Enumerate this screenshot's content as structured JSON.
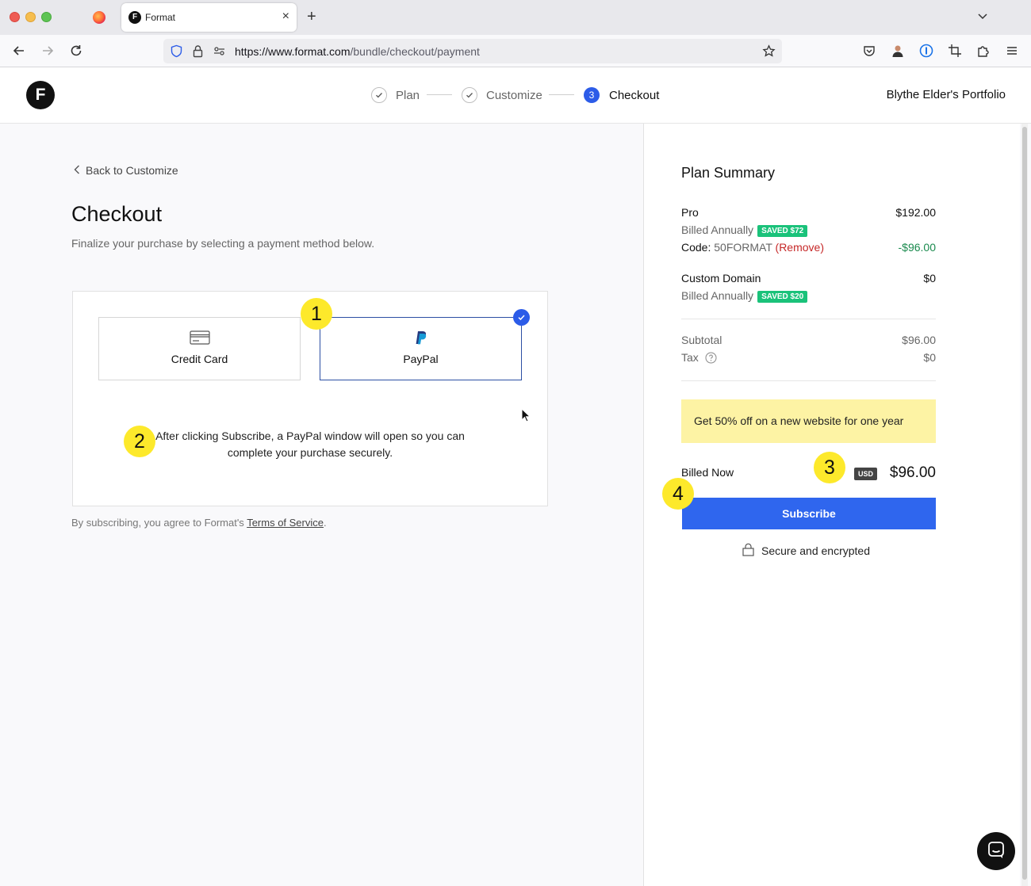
{
  "browser": {
    "tab_title": "Format",
    "tab_favicon_letter": "F",
    "url_scheme_host": "https://www.format.com",
    "url_path": "/bundle/checkout/payment"
  },
  "header": {
    "logo_letter": "F",
    "steps": [
      {
        "label": "Plan",
        "state": "done"
      },
      {
        "label": "Customize",
        "state": "done"
      },
      {
        "label": "Checkout",
        "state": "active",
        "number": "3"
      }
    ],
    "portfolio_name": "Blythe Elder's Portfolio"
  },
  "checkout": {
    "back_label": "Back to Customize",
    "title": "Checkout",
    "subtitle": "Finalize your purchase by selecting a payment method below.",
    "payment_options": [
      {
        "label": "Credit Card",
        "icon": "credit-card-icon",
        "selected": false
      },
      {
        "label": "PayPal",
        "icon": "paypal-icon",
        "selected": true
      }
    ],
    "paypal_info": "After clicking Subscribe, a PayPal window will open so you can complete your purchase securely.",
    "tos_prefix": "By subscribing, you agree to Format's ",
    "tos_link": "Terms of Service",
    "tos_suffix": "."
  },
  "summary": {
    "title": "Plan Summary",
    "pro_label": "Pro",
    "pro_price": "$192.00",
    "pro_billing": "Billed Annually",
    "pro_saved": "SAVED $72",
    "code_label": "Code:",
    "code_value": "50FORMAT",
    "code_remove": "(Remove)",
    "code_discount": "-$96.00",
    "domain_label": "Custom Domain",
    "domain_price": "$0",
    "domain_billing": "Billed Annually",
    "domain_saved": "SAVED $20",
    "subtotal_label": "Subtotal",
    "subtotal_value": "$96.00",
    "tax_label": "Tax",
    "tax_value": "$0",
    "promo": "Get 50% off on a new website for one year",
    "billed_now_label": "Billed Now",
    "currency": "USD",
    "billed_now_value": "$96.00",
    "subscribe_label": "Subscribe",
    "secure_label": "Secure and encrypted"
  },
  "annotations": [
    "1",
    "2",
    "3",
    "4"
  ],
  "colors": {
    "accent": "#2f66ee",
    "saved_badge": "#1ac27a",
    "promo_bg": "#fdf3a4",
    "marker": "#fde92b"
  }
}
